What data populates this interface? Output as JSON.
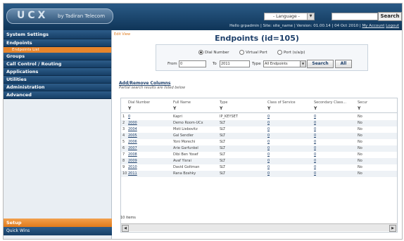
{
  "app": {
    "logo_text": "UCX",
    "logo_tagline": "by Tadiran Telecom",
    "language_select": "- Language -",
    "search_button": "Search",
    "user_info": "Hello grpadmin | Site: site_name | Version: 01.00.14 | 04 Oct 2010 | ",
    "my_account": "My Account",
    "logout": "Logout"
  },
  "sidebar": {
    "items": [
      {
        "label": "System Settings"
      },
      {
        "label": "Endpoints"
      },
      {
        "label": "Endpoints List"
      },
      {
        "label": "Groups"
      },
      {
        "label": "Call Control / Routing"
      },
      {
        "label": "Applications"
      },
      {
        "label": "Utilities"
      },
      {
        "label": "Administration"
      },
      {
        "label": "Advanced"
      }
    ],
    "setup": "Setup",
    "quick_wins": "Quick Wins"
  },
  "main": {
    "edit_view": "Edit View",
    "title": "Endpoints (id=105)",
    "radio_options": [
      "Dial Number",
      "Virtual Port",
      "Port (s/a/p)"
    ],
    "radio_selected": 0,
    "from_label": "From",
    "from_value": "0",
    "to_label": "To",
    "to_value": "2011",
    "type_label": "Type",
    "type_value": "All Endpoints",
    "search_button": "Search",
    "all_button": "All",
    "add_remove_columns": "Add/Remove Columns",
    "partial_note": "Partial search results are listed below",
    "columns": [
      "Dial Number",
      "Full Name",
      "Type",
      "Class of Service",
      "Secondary Class...",
      "Secur"
    ],
    "filter_icon": "funnel-icon",
    "rows": [
      {
        "n": "1",
        "dial": "0",
        "name": "Kapri",
        "type": "IP_KEYSET",
        "cos": "0",
        "scos": "0",
        "sec": "No"
      },
      {
        "n": "2",
        "dial": "2000",
        "name": "Demo Room-UCx",
        "type": "SLT",
        "cos": "0",
        "scos": "0",
        "sec": "No"
      },
      {
        "n": "3",
        "dial": "2004",
        "name": "Moti Liebovitz",
        "type": "SLT",
        "cos": "0",
        "scos": "0",
        "sec": "No"
      },
      {
        "n": "4",
        "dial": "2005",
        "name": "Gal Sendler",
        "type": "SLT",
        "cos": "0",
        "scos": "0",
        "sec": "No"
      },
      {
        "n": "5",
        "dial": "2006",
        "name": "Yoni Morechi",
        "type": "SLT",
        "cos": "0",
        "scos": "0",
        "sec": "No"
      },
      {
        "n": "6",
        "dial": "2007",
        "name": "Arie Garfunkel",
        "type": "SLT",
        "cos": "0",
        "scos": "0",
        "sec": "No"
      },
      {
        "n": "7",
        "dial": "2008",
        "name": "Dibi Ben Yosef",
        "type": "SLT",
        "cos": "0",
        "scos": "0",
        "sec": "No"
      },
      {
        "n": "8",
        "dial": "2009",
        "name": "Avaf Yisrai",
        "type": "SLT",
        "cos": "0",
        "scos": "0",
        "sec": "No"
      },
      {
        "n": "9",
        "dial": "2010",
        "name": "David Goltman",
        "type": "SLT",
        "cos": "0",
        "scos": "0",
        "sec": "No"
      },
      {
        "n": "10",
        "dial": "2011",
        "name": "Rana Bzahky",
        "type": "SLT",
        "cos": "0",
        "scos": "0",
        "sec": "No"
      }
    ],
    "item_count": "10 items"
  }
}
